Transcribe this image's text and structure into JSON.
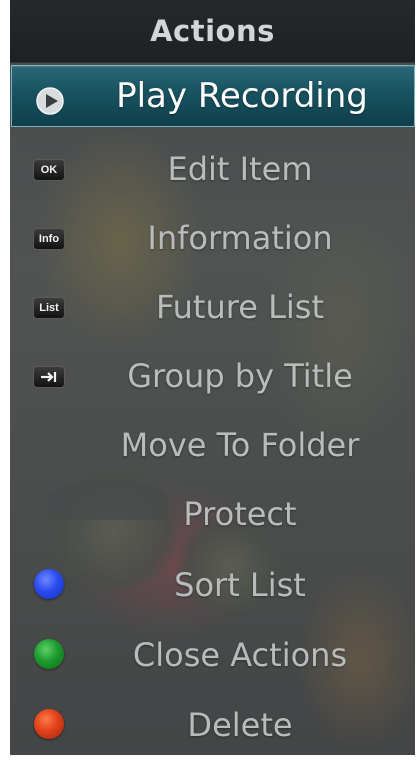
{
  "header": {
    "title": "Actions"
  },
  "menu": {
    "items": [
      {
        "label": "Play Recording",
        "icon": "play-icon",
        "selected": true
      },
      {
        "label": "Edit Item",
        "icon": "ok-key-icon",
        "key_text": "OK"
      },
      {
        "label": "Information",
        "icon": "info-key-icon",
        "key_text": "Info"
      },
      {
        "label": "Future List",
        "icon": "list-key-icon",
        "key_text": "List"
      },
      {
        "label": "Group by Title",
        "icon": "skip-arrow-key-icon"
      },
      {
        "label": "Move To Folder"
      },
      {
        "label": "Protect"
      },
      {
        "label": "Sort List",
        "icon": "blue-button-icon",
        "color": "#2a4bf0"
      },
      {
        "label": "Close Actions",
        "icon": "green-button-icon",
        "color": "#1d9a2d"
      },
      {
        "label": "Delete",
        "icon": "red-button-icon",
        "color": "#e0401a"
      }
    ]
  },
  "colors": {
    "header_bg": "#1f2325",
    "selected_bg": "#195462",
    "selected_border": "#7fb0bc",
    "label_text": "#b9bcbc",
    "selected_text": "#ffffff"
  }
}
